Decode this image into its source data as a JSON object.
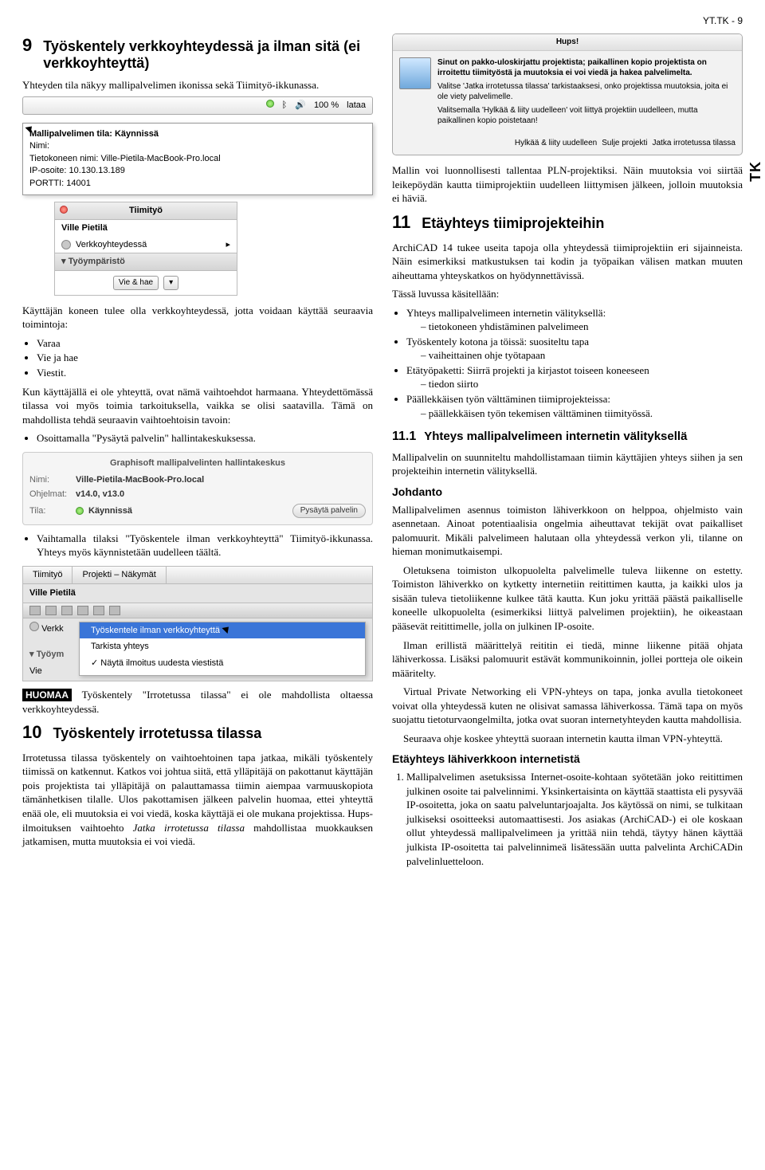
{
  "page": {
    "header": "YT.TK - 9",
    "side_tab": "TK"
  },
  "left": {
    "sec9": {
      "num": "9",
      "title": "Työskentely verkkoyhteydessä ja ilman sitä (ei verkkoyhteyttä)",
      "p1": "Yhteyden tila näkyy mallipalvelimen ikonissa sekä Tiimityö-ikkunassa."
    },
    "menubar": {
      "pct": "100 %",
      "mode": "lataa"
    },
    "tooltip": {
      "l1": "Mallipalvelimen tila: Käynnissä",
      "l2": "Nimi:",
      "l3": "Tietokoneen nimi: Ville-Pietila-MacBook-Pro.local",
      "l4": "IP-osoite: 10.130.13.189",
      "l5": "PORTTI: 14001"
    },
    "panel1": {
      "title": "Tiimityö",
      "user": "Ville Pietilä",
      "status": "Verkkoyhteydessä",
      "section": "Työympäristö",
      "btn": "Vie & hae"
    },
    "p2": "Käyttäjän koneen tulee olla verkkoyhteydessä, jotta voidaan käyttää seuraavia toimintoja:",
    "list1": {
      "a": "Varaa",
      "b": "Vie ja hae",
      "c": "Viestit."
    },
    "p3": "Kun käyttäjällä ei ole yhteyttä, ovat nämä vaihtoehdot harmaana. Yhteydettömässä tilassa voi myös toimia tarkoituksella, vaikka se olisi saatavilla. Tämä on mahdollista tehdä seuraavin vaihtoehtoisin tavoin:",
    "list2": {
      "a": "Osoittamalla \"Pysäytä palvelin\" hallintakeskuksessa."
    },
    "hallinta": {
      "title": "Graphisoft mallipalvelinten hallintakeskus",
      "nimi_label": "Nimi:",
      "nimi": "Ville-Pietila-MacBook-Pro.local",
      "ohjelmat_label": "Ohjelmat:",
      "ohjelmat": "v14.0, v13.0",
      "tila_label": "Tila:",
      "tila": "Käynnissä",
      "btn": "Pysäytä palvelin"
    },
    "list3": {
      "a": "Vaihtamalla tilaksi \"Työskentele ilman verkkoyhteyttä\" Tiimityö-ikkunassa. Yhteys myös käynnistetään uudelleen täältä."
    },
    "menu": {
      "tab1": "Tiimityö",
      "tab2": "Projekti – Näkymät",
      "user": "Ville Pietilä",
      "verkk": "Verkk",
      "tyoym": "Työym",
      "vie": "Vie",
      "m1": "Työskentele ilman verkkoyhteyttä",
      "m2": "Tarkista yhteys",
      "m3": "Näytä ilmoitus uudesta viestistä"
    },
    "huomaa_label": "HUOMAA",
    "huomaa_text": " Työskentely \"Irrotetussa tilassa\" ei ole mahdollista oltaessa verkkoyhteydessä.",
    "sec10": {
      "num": "10",
      "title": "Työskentely irrotetussa tilassa"
    },
    "p10a": "Irrotetussa tilassa työskentely on vaihtoehtoinen tapa jatkaa, mikäli työskentely tiimissä on katkennut. Katkos voi johtua siitä, että ylläpitäjä on pakottanut käyttäjän pois projektista tai ylläpitäjä on palauttamassa tiimin aiempaa varmuuskopiota tämänhetkisen tilalle. Ulos pakottamisen jälkeen palvelin huomaa, ettei yhteyttä enää ole, eli muutoksia ei voi viedä, koska käyttäjä ei ole mukana projektissa. Hups-ilmoituksen vaihtoehto ",
    "p10a_em": "Jatka irrotetussa tilassa",
    "p10a_tail": " mahdollistaa muokkauksen jatkamisen, mutta muutoksia ei voi viedä."
  },
  "right": {
    "hups": {
      "title": "Hups!",
      "l1": "Sinut on pakko-uloskirjattu projektista; paikallinen kopio projektista on irroitettu tiimityöstä ja muutoksia ei voi viedä ja hakea palvelimelta.",
      "l2": "Valitse 'Jatka irrotetussa tilassa' tarkistaaksesi, onko projektissa muutoksia, joita ei ole viety palvelimelle.",
      "l3": "Valitsemalla 'Hylkää & liity uudelleen' voit liittyä projektiin uudelleen, mutta paikallinen kopio poistetaan!",
      "b1": "Hylkää & liity uudelleen",
      "b2": "Sulje projekti",
      "b3": "Jatka irrotetussa tilassa"
    },
    "p_intro1": "Mallin voi luonnollisesti tallentaa PLN-projektiksi. Näin muutoksia voi siirtää leikepöydän kautta tiimiprojektiin uudelleen liittymisen jälkeen, jolloin muutoksia ei häviä.",
    "sec11": {
      "num": "11",
      "title": "Etäyhteys tiimiprojekteihin"
    },
    "p11a": "ArchiCAD 14 tukee useita tapoja olla yhteydessä tiimiprojektiin eri sijainneista. Näin esimerkiksi matkustuksen tai kodin ja työpaikan välisen matkan muuten aiheuttama yhteyskatkos on hyödynnettävissä.",
    "p11b": "Tässä luvussa käsitellään:",
    "l11": {
      "a": "Yhteys mallipalvelimeen internetin välityksellä:",
      "a1": "tietokoneen yhdistäminen palvelimeen",
      "b": "Työskentely kotona ja töissä: suositeltu tapa",
      "b1": "vaiheittainen ohje työtapaan",
      "c": "Etätyöpaketti: Siirrä projekti ja kirjastot toiseen koneeseen",
      "c1": "tiedon siirto",
      "d": "Päällekkäisen työn välttäminen tiimiprojekteissa:",
      "d1": "päällekkäisen työn tekemisen välttäminen tiimityössä."
    },
    "sec11_1": {
      "num": "11.1",
      "title": "Yhteys mallipalvelimeen internetin välityksellä"
    },
    "p11_1": "Mallipalvelin on suunniteltu mahdollistamaan tiimin käyttäjien yhteys siihen ja sen projekteihin internetin välityksellä.",
    "johdanto": "Johdanto",
    "pj1": "Mallipalvelimen asennus toimiston lähiverkkoon on helppoa, ohjelmisto vain asennetaan. Ainoat potentiaalisia ongelmia aiheuttavat tekijät ovat paikalliset palomuurit. Mikäli palvelimeen halutaan olla yhteydessä verkon yli, tilanne on hieman monimutkaisempi.",
    "pj2": "Oletuksena toimiston ulkopuolelta palvelimelle tuleva liikenne on estetty. Toimiston lähiverkko on kytketty internetiin reitittimen kautta, ja kaikki ulos ja sisään tuleva tietoliikenne kulkee tätä kautta. Kun joku yrittää päästä paikalliselle koneelle ulkopuolelta (esimerkiksi liittyä palvelimen projektiin), he oikeastaan pääsevät reitittimelle, jolla on julkinen IP-osoite.",
    "pj3": "Ilman erillistä määrittelyä reititin ei tiedä, minne liikenne pitää ohjata lähiverkossa. Lisäksi palomuurit estävät kommunikoinnin, jollei portteja ole oikein määritelty.",
    "pj4": "Virtual Private Networking eli VPN-yhteys on tapa, jonka avulla tietokoneet voivat olla yhteydessä kuten ne olisivat samassa lähiverkossa. Tämä tapa on myös suojattu tietoturvaongelmilta, jotka ovat suoran internetyhteyden kautta mahdollisia.",
    "pj5": "Seuraava ohje koskee yhteyttä suoraan internetin kautta ilman VPN-yhteyttä.",
    "etayhteys": "Etäyhteys lähiverkkoon internetistä",
    "ol1": "Mallipalvelimen asetuksissa Internet-osoite-kohtaan syötetään joko reitittimen julkinen osoite tai palvelinnimi. Yksinkertaisinta on käyttää staattista eli pysyvää IP-osoitetta, joka on saatu palveluntarjoajalta. Jos käytössä on nimi, se tulkitaan julkiseksi osoitteeksi automaattisesti. Jos asiakas (ArchiCAD-) ei ole koskaan ollut yhteydessä mallipalvelimeen ja yrittää niin tehdä, täytyy hänen käyttää julkista IP-osoitetta tai palvelinnimeä lisätessään uutta palvelinta ArchiCADin palvelinluetteloon."
  }
}
